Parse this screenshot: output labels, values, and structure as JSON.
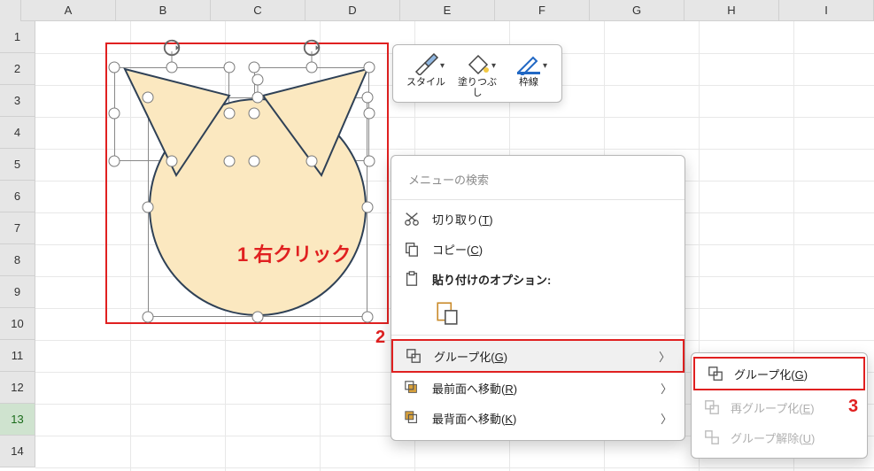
{
  "grid": {
    "columns": [
      "A",
      "B",
      "C",
      "D",
      "E",
      "F",
      "G",
      "H",
      "I"
    ],
    "rows": [
      "1",
      "2",
      "3",
      "4",
      "5",
      "6",
      "7",
      "8",
      "9",
      "10",
      "11",
      "12",
      "13",
      "14"
    ],
    "selected_row": "13"
  },
  "annotations": {
    "step1": "1 右クリック",
    "step2": "2",
    "step3": "3"
  },
  "mini_toolbar": {
    "style": "スタイル",
    "fill": "塗りつぶし",
    "outline": "枠線"
  },
  "context_menu": {
    "search_placeholder": "メニューの検索",
    "cut": "切り取り(T)",
    "copy": "コピー(C)",
    "paste_options_label": "貼り付けのオプション:",
    "group": "グループ化(G)",
    "bring_front": "最前面へ移動(R)",
    "send_back": "最背面へ移動(K)"
  },
  "submenu": {
    "group": "グループ化(G)",
    "regroup": "再グループ化(E)",
    "ungroup": "グループ解除(U)"
  },
  "colors": {
    "shape_fill": "#fbe8c0",
    "shape_stroke": "#2f4156",
    "red": "#e02020"
  }
}
